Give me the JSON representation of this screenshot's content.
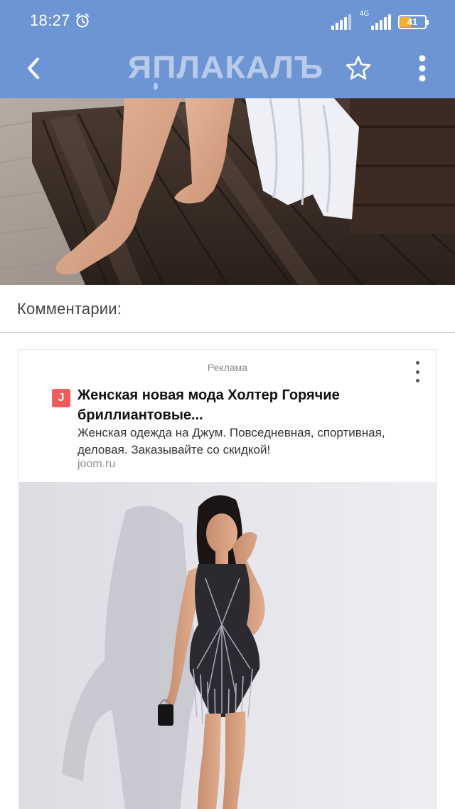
{
  "status_bar": {
    "time": "18:27",
    "network": "4G",
    "battery": "41",
    "battery_level": 0.41
  },
  "app_bar": {
    "logo": "ЯПЛАКАЛЪ",
    "back_icon": "chevron-left-icon",
    "star_icon": "star-outline-icon",
    "menu_icon": "more-vertical-icon"
  },
  "comments": {
    "title": "Комментарии:"
  },
  "ad": {
    "label": "Реклама",
    "favicon": "J",
    "title": "Женская новая мода Холтер Горячие бриллиантовые...",
    "description": "Женская одежда на Джум. Повседневная, спортивная, деловая. Заказывайте со скидкой!",
    "domain": "joom.ru"
  },
  "colors": {
    "app_bar": "#6d95d3",
    "battery": "#f2b230",
    "favicon": "#f25b5b"
  }
}
